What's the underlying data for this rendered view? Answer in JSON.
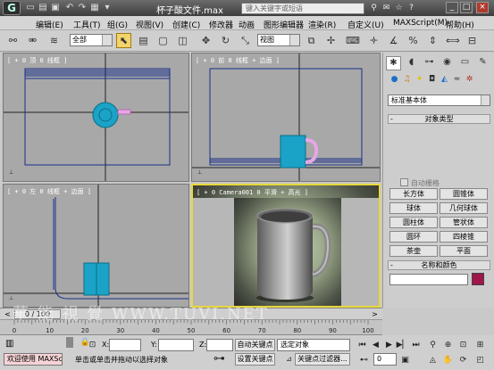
{
  "titlebar": {
    "logo": "G",
    "title": "杯子酸文件.max",
    "search_placeholder": "键入关键字或短语",
    "window_buttons": [
      "_",
      "□",
      "×"
    ]
  },
  "menubar": {
    "items": [
      "编辑(E)",
      "工具(T)",
      "组(G)",
      "视图(V)",
      "创建(C)",
      "修改器",
      "动画",
      "图形编辑器",
      "渲染(R)",
      "自定义(U)",
      "MAXScript(M)",
      "帮助(H)"
    ]
  },
  "toolbar": {
    "filter_value": "全部",
    "refcoord_value": "视图"
  },
  "viewports": {
    "top": "[ + 0 顶 0 线框 ]",
    "front": "[ + 0 前 0 线框 + 边面 ]",
    "left": "[ + 0 左 0 线框 + 边面 ]",
    "persp": "[ + 0 Camera001 0 平滑 + 高光 ]"
  },
  "command_panel": {
    "category": "标准基本体",
    "object_type_title": "对象类型",
    "autogrid": "自动栅格",
    "buttons": [
      "长方体",
      "圆锥体",
      "球体",
      "几何球体",
      "圆柱体",
      "管状体",
      "圆环",
      "四棱锥",
      "茶壶",
      "平面"
    ],
    "name_color_title": "名称和颜色",
    "section_toggle": "-",
    "swatch_color": "#a0154a"
  },
  "timeline": {
    "frame_label": "0 / 100",
    "ticks": [
      "0",
      "10",
      "20",
      "30",
      "40",
      "50",
      "60",
      "70",
      "80",
      "90",
      "100"
    ]
  },
  "statusbar": {
    "maxscript_label": "欢迎使用 MAXSc",
    "x_label": "X:",
    "y_label": "Y:",
    "z_label": "Z:",
    "autokey": "自动关键点",
    "setkey": "设置关键点",
    "selection_set": "选定对象",
    "key_filters": "关键点过滤器...",
    "prompt": "单击或单击并拖动以选择对象",
    "frame_value": "0"
  },
  "watermark": "華 能 視 覺  WWW.TUVI.NET"
}
